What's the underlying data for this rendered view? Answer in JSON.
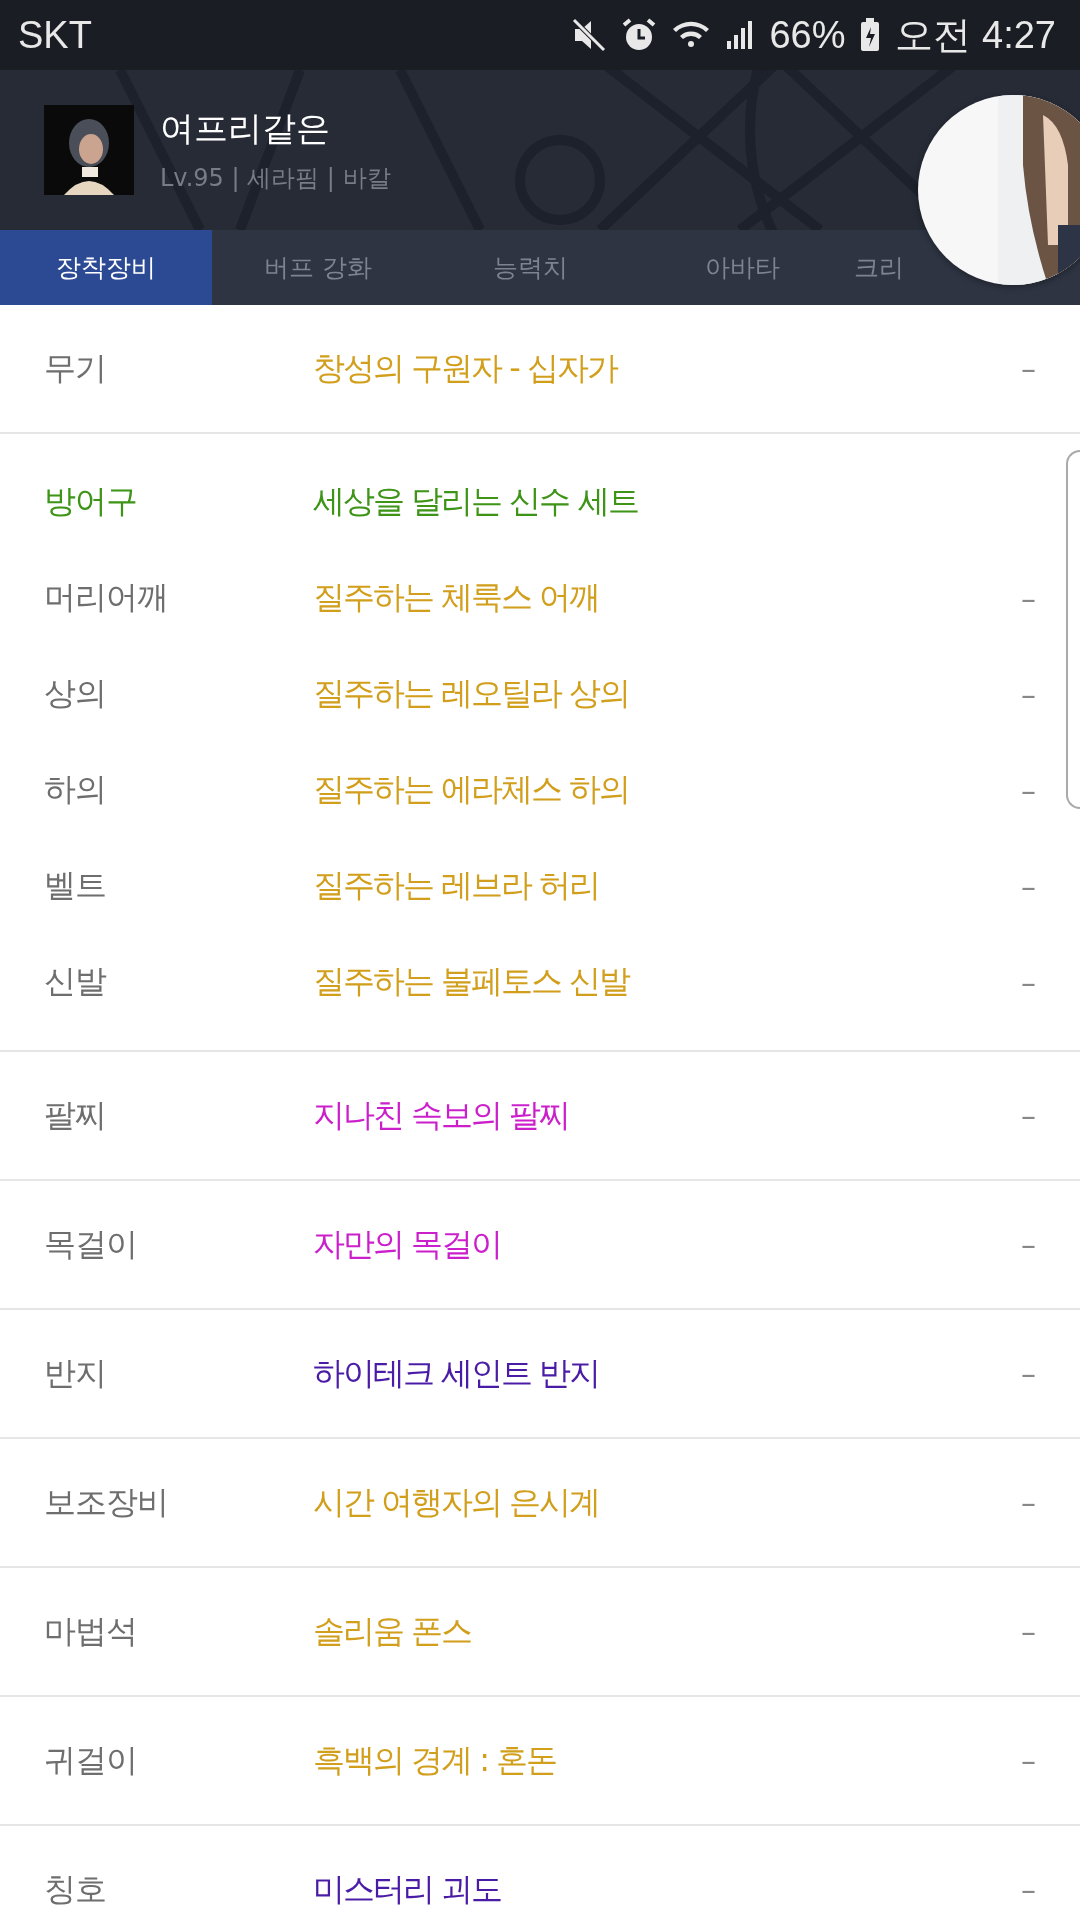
{
  "status_bar": {
    "carrier": "SKT",
    "battery": "66%",
    "time": "오전 4:27"
  },
  "character": {
    "name": "여프리같은",
    "info": "Lv.95 | 세라핌 | 바칼"
  },
  "tabs": [
    {
      "label": "장착장비",
      "selected": true
    },
    {
      "label": "버프 강화",
      "selected": false
    },
    {
      "label": "능력치",
      "selected": false
    },
    {
      "label": "아바타",
      "selected": false
    },
    {
      "label": "크리",
      "selected": false
    }
  ],
  "sections": [
    {
      "rows": [
        {
          "kind": "item",
          "slot": "무기",
          "item": "창성의 구원자 - 십자가",
          "color": "#d29f1c",
          "value": "–"
        }
      ]
    },
    {
      "rows": [
        {
          "kind": "set",
          "slot": "방어구",
          "item": "세상을 달리는 신수 세트",
          "color": "#3d9417"
        },
        {
          "kind": "item",
          "slot": "머리어깨",
          "item": "질주하는 체룩스 어깨",
          "color": "#d29f1c",
          "value": "–"
        },
        {
          "kind": "item",
          "slot": "상의",
          "item": "질주하는 레오틸라 상의",
          "color": "#d29f1c",
          "value": "–"
        },
        {
          "kind": "item",
          "slot": "하의",
          "item": "질주하는 에라체스 하의",
          "color": "#d29f1c",
          "value": "–"
        },
        {
          "kind": "item",
          "slot": "벨트",
          "item": "질주하는 레브라 허리",
          "color": "#d29f1c",
          "value": "–"
        },
        {
          "kind": "item",
          "slot": "신발",
          "item": "질주하는 불페토스 신발",
          "color": "#d29f1c",
          "value": "–"
        }
      ]
    },
    {
      "rows": [
        {
          "kind": "item",
          "slot": "팔찌",
          "item": "지나친 속보의 팔찌",
          "color": "#cc1fcc",
          "value": "–"
        }
      ]
    },
    {
      "rows": [
        {
          "kind": "item",
          "slot": "목걸이",
          "item": "자만의 목걸이",
          "color": "#cc1fcc",
          "value": "–"
        }
      ]
    },
    {
      "rows": [
        {
          "kind": "item",
          "slot": "반지",
          "item": "하이테크 세인트 반지",
          "color": "#4a1ba6",
          "value": "–"
        }
      ]
    },
    {
      "rows": [
        {
          "kind": "item",
          "slot": "보조장비",
          "item": "시간 여행자의 은시계",
          "color": "#d29f1c",
          "value": "–"
        }
      ]
    },
    {
      "rows": [
        {
          "kind": "item",
          "slot": "마법석",
          "item": "솔리움 폰스",
          "color": "#d29f1c",
          "value": "–"
        }
      ]
    },
    {
      "rows": [
        {
          "kind": "item",
          "slot": "귀걸이",
          "item": "흑백의 경계 : 혼돈",
          "color": "#d29f1c",
          "value": "–"
        }
      ]
    },
    {
      "rows": [
        {
          "kind": "item",
          "slot": "칭호",
          "item": "미스터리 괴도",
          "color": "#4a1ba6",
          "value": "–"
        }
      ]
    }
  ]
}
